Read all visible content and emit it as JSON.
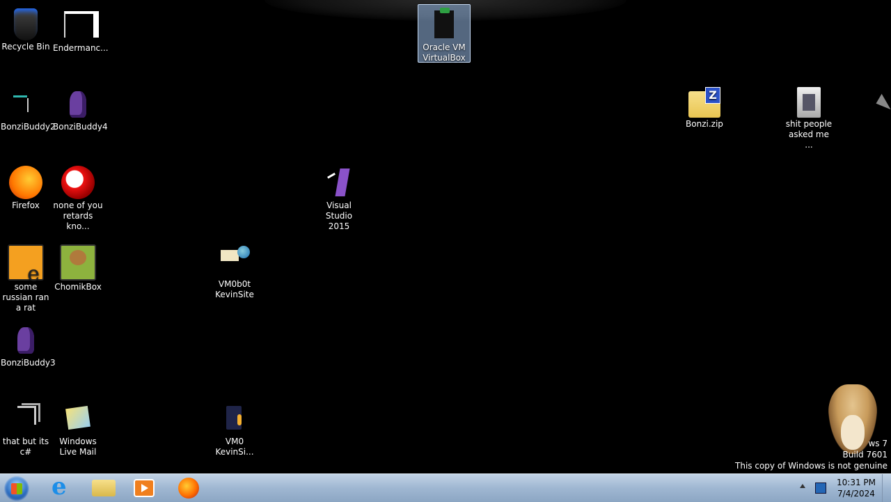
{
  "desktop": {
    "icons": [
      {
        "id": "recycle-bin",
        "label": "Recycle Bin"
      },
      {
        "id": "endermanch",
        "label": "Endermanc..."
      },
      {
        "id": "bonzibuddy2",
        "label": "BonziBuddy2"
      },
      {
        "id": "bonzibuddy4",
        "label": "BonziBuddy4"
      },
      {
        "id": "firefox",
        "label": "Firefox"
      },
      {
        "id": "none-of-you",
        "label": "none of you retards kno..."
      },
      {
        "id": "some-russian",
        "label": "some russian ran a rat"
      },
      {
        "id": "chomikbox",
        "label": "ChomikBox"
      },
      {
        "id": "bonzibuddy3",
        "label": "BonziBuddy3"
      },
      {
        "id": "that-but-its-csharp",
        "label": "that but its c#"
      },
      {
        "id": "windows-live-mail",
        "label": "Windows Live Mail"
      },
      {
        "id": "vm0b0t-kevinsite",
        "label": "VM0b0t KevinSite"
      },
      {
        "id": "vm0-kevinsi",
        "label": "VM0 KevinSi..."
      },
      {
        "id": "visual-studio-2015",
        "label": "Visual Studio 2015"
      },
      {
        "id": "oracle-vm-virtualbox",
        "label": "Oracle VM VirtualBox"
      },
      {
        "id": "bonzi-zip",
        "label": "Bonzi.zip"
      },
      {
        "id": "shit-people-asked-me",
        "label": "shit people asked me ..."
      }
    ]
  },
  "watermark": {
    "line1": "ws 7",
    "line2": "Build 7601",
    "line3": "This copy of Windows is not genuine"
  },
  "taskbar": {
    "pinned": [
      "internet-explorer-icon",
      "windows-explorer-icon",
      "windows-media-player-icon",
      "firefox-icon"
    ],
    "clock": {
      "time": "10:31 PM",
      "date": "7/4/2024"
    }
  },
  "colors": {
    "desktop_bg": "#000000",
    "taskbar_top": "#c2d3e6",
    "taskbar_bottom": "#8ca6c3",
    "selection": "#99bbe8"
  }
}
